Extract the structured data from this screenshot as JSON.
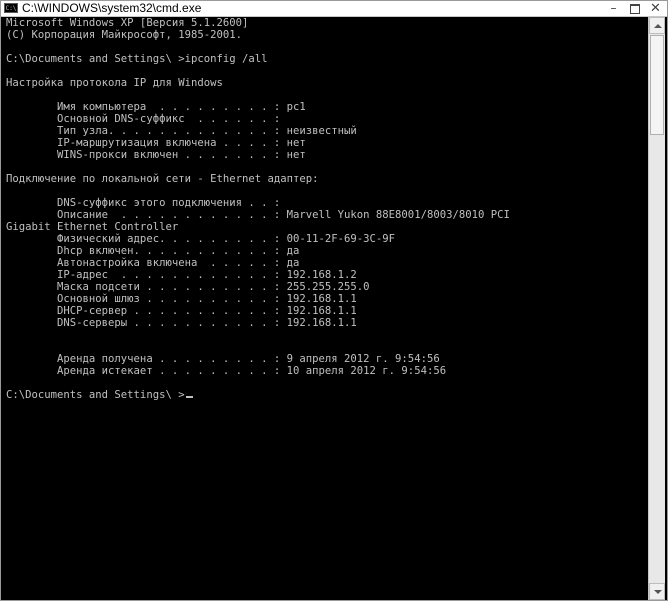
{
  "window": {
    "title": "C:\\WINDOWS\\system32\\cmd.exe",
    "icon_label": "C:\\",
    "minimize_glyph": "–",
    "close_glyph": "✕"
  },
  "console": {
    "lines": [
      "Microsoft Windows XP [Версия 5.1.2600]",
      "(С) Корпорация Майкрософт, 1985-2001.",
      "",
      "C:\\Documents and Settings\\ >ipconfig /all",
      "",
      "Настройка протокола IP для Windows",
      "",
      "        Имя компьютера  . . . . . . . . . : pc1",
      "        Основной DNS-суффикс  . . . . . . :",
      "        Тип узла. . . . . . . . . . . . . : неизвестный",
      "        IP-маршрутизация включена . . . . : нет",
      "        WINS-прокси включен . . . . . . . : нет",
      "",
      "Подключение по локальной сети - Ethernet адаптер:",
      "",
      "        DNS-суффикс этого подключения . . :",
      "        Описание  . . . . . . . . . . . . : Marvell Yukon 88E8001/8003/8010 PCI",
      "Gigabit Ethernet Controller",
      "        Физический адрес. . . . . . . . . : 00-11-2F-69-3C-9F",
      "        Dhcp включен. . . . . . . . . . . : да",
      "        Автонастройка включена  . . . . . : да",
      "        IP-адрес  . . . . . . . . . . . . : 192.168.1.2",
      "        Маска подсети . . . . . . . . . . : 255.255.255.0",
      "        Основной шлюз . . . . . . . . . . : 192.168.1.1",
      "        DHCP-сервер . . . . . . . . . . . : 192.168.1.1",
      "        DNS-серверы . . . . . . . . . . . : 192.168.1.1",
      "",
      "",
      "        Аренда получена . . . . . . . . . : 9 апреля 2012 г. 9:54:56",
      "        Аренда истекает . . . . . . . . . : 10 апреля 2012 г. 9:54:56",
      "",
      "C:\\Documents and Settings\\ >"
    ]
  },
  "colors": {
    "console_bg": "#000000",
    "console_fg": "#c0c0c0",
    "titlebar_bg": "#ffffff"
  }
}
